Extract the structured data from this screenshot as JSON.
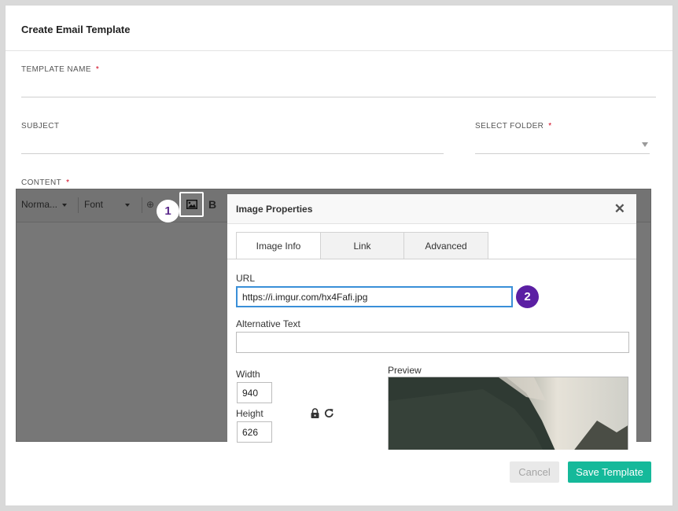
{
  "modal": {
    "title": "Create Email Template"
  },
  "form": {
    "template_name_label": "TEMPLATE NAME",
    "subject_label": "SUBJECT",
    "folder_label": "SELECT FOLDER",
    "content_label": "CONTENT",
    "required_mark": "*"
  },
  "toolbar": {
    "format_combo": "Norma...",
    "font_combo": "Font",
    "bold_label": "B"
  },
  "steps": {
    "one": "1",
    "two": "2"
  },
  "dialog": {
    "title": "Image Properties",
    "close_glyph": "✕",
    "tabs": [
      {
        "label": "Image Info",
        "active": true
      },
      {
        "label": "Link",
        "active": false
      },
      {
        "label": "Advanced",
        "active": false
      }
    ],
    "url_label": "URL",
    "url_value": "https://i.imgur.com/hx4Fafi.jpg",
    "alt_label": "Alternative Text",
    "alt_value": "",
    "width_label": "Width",
    "width_value": "940",
    "height_label": "Height",
    "height_value": "626",
    "preview_label": "Preview"
  },
  "footer": {
    "cancel_label": "Cancel",
    "save_label": "Save Template"
  },
  "colors": {
    "accent": "#15b99a",
    "badge": "#5b1fa3",
    "required": "#d0021b",
    "focus": "#3a8fd8"
  }
}
